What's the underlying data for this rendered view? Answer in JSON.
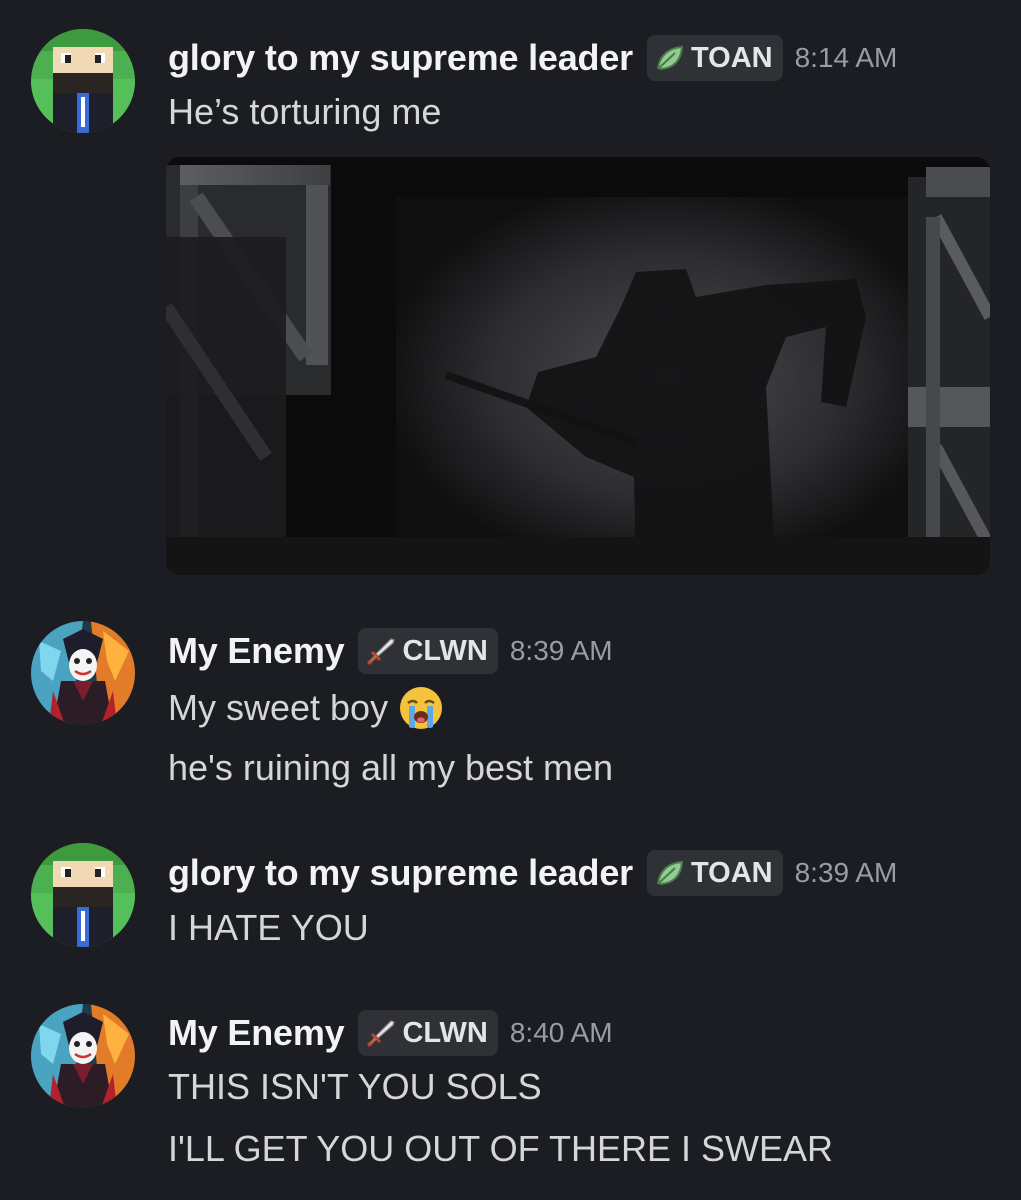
{
  "messages": [
    {
      "username": "glory to my supreme leader",
      "tag": "TOAN",
      "tag_icon": "leaf-icon",
      "timestamp": "8:14 AM",
      "lines": [
        "He’s torturing me"
      ],
      "attachment": "shadow-figure-with-scythe-image"
    },
    {
      "username": "My Enemy",
      "tag": "CLWN",
      "tag_icon": "sword-icon",
      "timestamp": "8:39 AM",
      "lines": [
        "My sweet boy",
        "he's ruining all my best men"
      ],
      "emoji": "loudly-crying-face-emoji"
    },
    {
      "username": "glory to my supreme leader",
      "tag": "TOAN",
      "tag_icon": "leaf-icon",
      "timestamp": "8:39 AM",
      "lines": [
        "I HATE YOU"
      ]
    },
    {
      "username": "My Enemy",
      "tag": "CLWN",
      "tag_icon": "sword-icon",
      "timestamp": "8:40 AM",
      "lines": [
        "THIS ISN'T YOU SOLS",
        "I'LL GET YOU OUT OF THERE I SWEAR"
      ]
    }
  ],
  "colors": {
    "background": "#1c1d22",
    "username": "#f2f3f5",
    "timestamp": "#9a9ca3",
    "tag_background": "#2f3136"
  }
}
